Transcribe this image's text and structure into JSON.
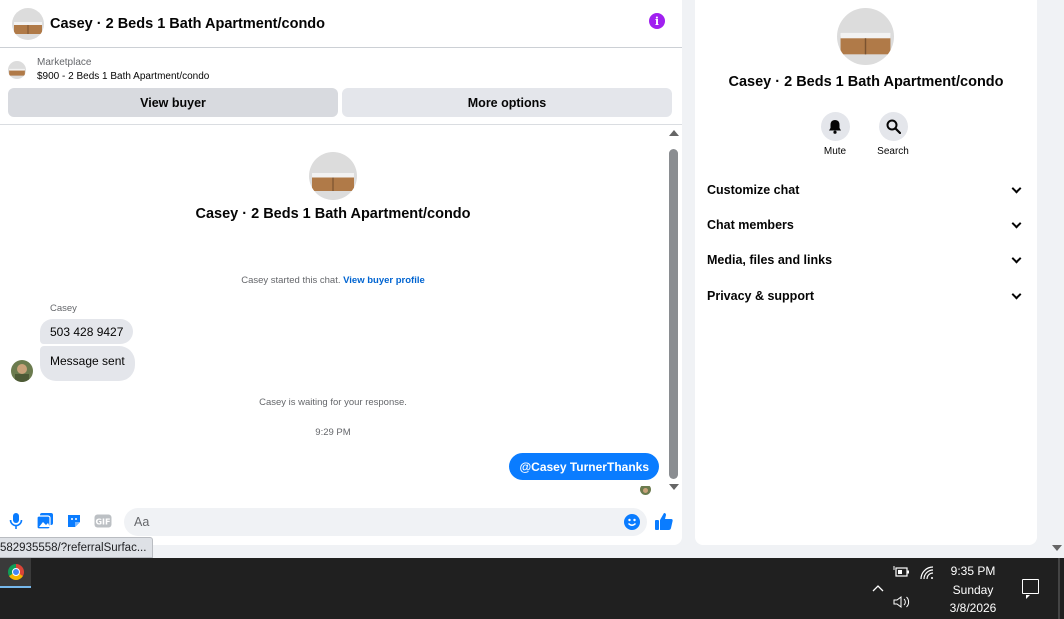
{
  "header": {
    "title": "Casey · 2 Beds 1 Bath Apartment/condo",
    "info_icon": "info-icon"
  },
  "marketplace": {
    "label": "Marketplace",
    "listing": "$900 - 2 Beds 1 Bath Apartment/condo"
  },
  "buttons": {
    "view_buyer": "View buyer",
    "more_options": "More options"
  },
  "thread": {
    "title": "Casey · 2 Beds 1 Bath Apartment/condo",
    "started_text": "Casey started this chat.",
    "started_link": "View buyer profile",
    "sender_name": "Casey",
    "messages_in": [
      "503 428 9427",
      "Message sent"
    ],
    "waiting_text": "Casey is waiting for your response.",
    "timestamp": "9:29 PM",
    "outgoing_mention": "@Casey Turner",
    "outgoing_text": "Thanks"
  },
  "composer": {
    "placeholder": "Aa"
  },
  "status_bar": {
    "url": "582935558/?referralSurfac..."
  },
  "side": {
    "title": "Casey · 2 Beds 1 Bath Apartment/condo",
    "actions": [
      {
        "label": "Mute",
        "icon": "bell-icon"
      },
      {
        "label": "Search",
        "icon": "search-icon"
      }
    ],
    "sections": [
      "Customize chat",
      "Chat members",
      "Media, files and links",
      "Privacy & support"
    ]
  },
  "taskbar": {
    "time": "9:35 PM",
    "day": "Sunday",
    "date": "3/8/2026"
  },
  "colors": {
    "accent": "#0a7cff",
    "info": "#a020f0",
    "link": "#0064d1"
  }
}
